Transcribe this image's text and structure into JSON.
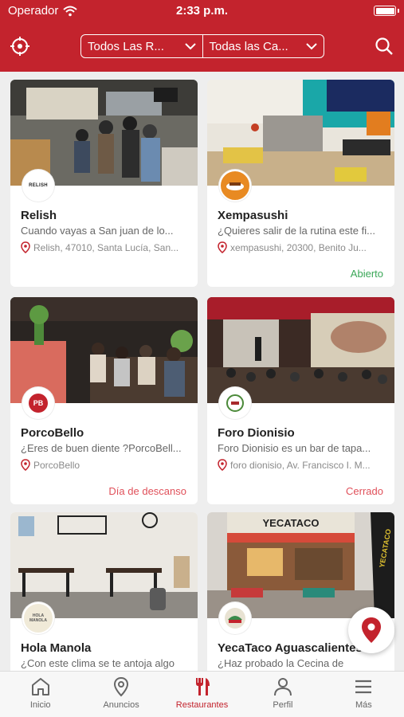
{
  "status_bar": {
    "carrier": "Operador",
    "time": "2:33 p.m."
  },
  "header": {
    "filter_region": "Todos Las R...",
    "filter_category": "Todas las Ca...",
    "locate_icon": "crosshair-icon",
    "search_icon": "search-icon"
  },
  "restaurants": [
    {
      "name": "Relish",
      "description": "Cuando vayas a San juan de lo...",
      "address": "Relish, 47010, Santa Lucía, San...",
      "status": "",
      "logo_text": "RELISH"
    },
    {
      "name": "Xempasushi",
      "description": "¿Quieres salir de la rutina este fi...",
      "address": "xempasushi, 20300, Benito Ju...",
      "status": "Abierto",
      "logo_text": ""
    },
    {
      "name": "PorcoBello",
      "description": "¿Eres de buen diente ?PorcoBell...",
      "address": "PorcoBello",
      "status": "Día de descanso",
      "logo_text": "PB"
    },
    {
      "name": "Foro Dionisio",
      "description": "Foro Dionisio es un bar de tapa...",
      "address": "foro dionisio, Av. Francisco I. M...",
      "status": "Cerrado",
      "logo_text": ""
    },
    {
      "name": "Hola Manola",
      "description": "¿Con este clima se te antoja algo",
      "address": "",
      "status": "",
      "logo_text": "HOLA MANOLA"
    },
    {
      "name": "YecaTaco Aguascalientes",
      "description": "¿Haz probado la Cecina de",
      "address": "",
      "status": "",
      "logo_text": ""
    }
  ],
  "photo_signs": {
    "yecataco_sign": "YECATACO"
  },
  "tabs": [
    {
      "label": "Inicio",
      "icon": "home-icon"
    },
    {
      "label": "Anuncios",
      "icon": "location-pin-icon"
    },
    {
      "label": "Restaurantes",
      "icon": "fork-knife-icon"
    },
    {
      "label": "Perfil",
      "icon": "person-icon"
    },
    {
      "label": "Más",
      "icon": "menu-icon"
    }
  ],
  "colors": {
    "brand": "#c3232d",
    "open": "#3aa757",
    "closed": "#e0505a"
  }
}
